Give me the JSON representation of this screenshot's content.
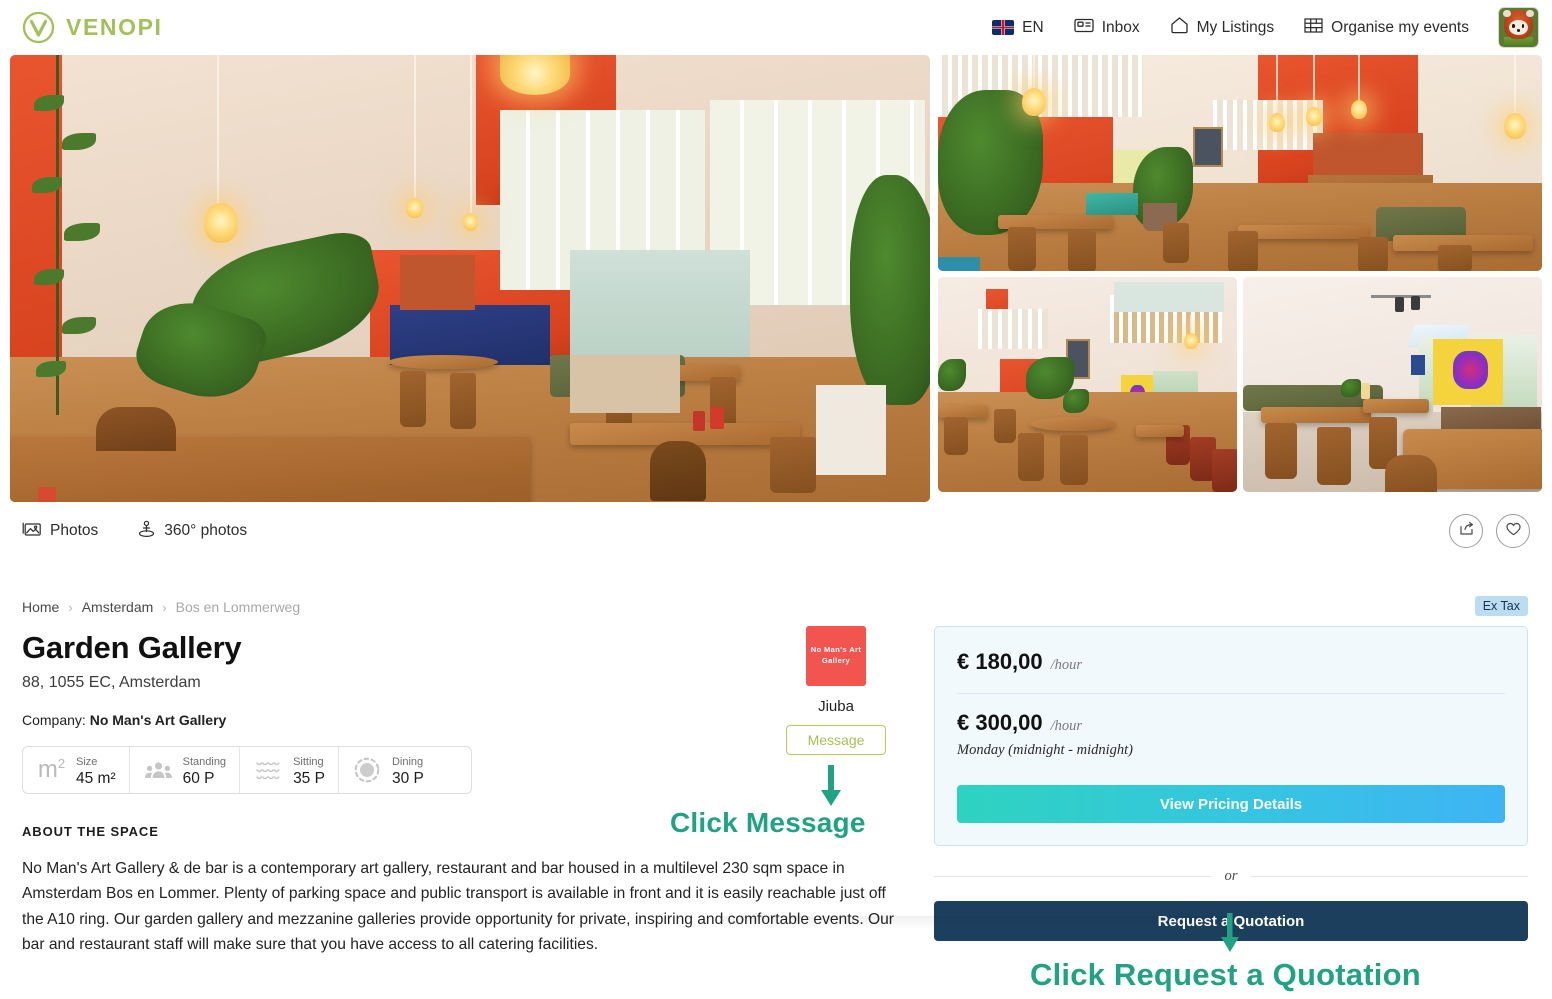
{
  "header": {
    "brand": "VENOPI",
    "brand_color": "#a4c05b",
    "nav": [
      {
        "label": "EN",
        "icon": "uk-flag-icon"
      },
      {
        "label": "Inbox",
        "icon": "inbox-icon"
      },
      {
        "label": "My Listings",
        "icon": "home-icon"
      },
      {
        "label": "Organise my events",
        "icon": "calendar-grid-icon"
      }
    ],
    "avatar_alt": "red-panda-avatar"
  },
  "gallery": {
    "tabs": [
      {
        "label": "Photos",
        "icon": "photos-icon"
      },
      {
        "label": "360° photos",
        "icon": "panorama-person-icon"
      }
    ],
    "actions": [
      {
        "name": "share-button",
        "icon": "share-icon"
      },
      {
        "name": "favourite-button",
        "icon": "heart-icon"
      }
    ]
  },
  "breadcrumb": {
    "home": "Home",
    "city": "Amsterdam",
    "street": "Bos en Lommerweg",
    "separator": "›"
  },
  "listing": {
    "title": "Garden Gallery",
    "address": "88, 1055 EC, Amsterdam",
    "company_label": "Company:",
    "company_name": "No Man's Art Gallery",
    "specs": [
      {
        "icon": "square-meter-icon",
        "label": "Size",
        "value": "45 m²"
      },
      {
        "icon": "standing-people-icon",
        "label": "Standing",
        "value": "60 P"
      },
      {
        "icon": "sitting-rows-icon",
        "label": "Sitting",
        "value": "35 P"
      },
      {
        "icon": "dining-table-icon",
        "label": "Dining",
        "value": "30 P"
      }
    ],
    "about_heading": "ABOUT THE SPACE",
    "about_text": "No Man's Art Gallery & de bar is a contemporary art gallery, restaurant and bar housed in a multilevel 230 sqm space in Amsterdam Bos en Lommer. Plenty of parking space and public transport is available in front and it is easily reachable just off the A10 ring. Our garden gallery and mezzanine galleries provide opportunity for private, inspiring and comfortable events. Our bar and restaurant staff will make sure that you have access to all catering facilities."
  },
  "host": {
    "logo_text": "No Man's Art Gallery",
    "logo_color": "#f2544f",
    "name": "Jiuba",
    "message_button": "Message",
    "message_button_color": "#a8bf55"
  },
  "booking": {
    "ex_tax_badge": "Ex Tax",
    "primary_price": "€ 180,00",
    "primary_price_unit": "/hour",
    "secondary_price": "€ 300,00",
    "secondary_price_unit": "/hour",
    "secondary_price_note": "Monday (midnight - midnight)",
    "pricing_details_button": "View Pricing Details",
    "or_text": "or",
    "quotation_button": "Request a Quotation",
    "accent_gradient_start": "#2ed3bf",
    "accent_gradient_end": "#3fb4f4",
    "quotation_color": "#1d3f5e"
  },
  "annotations": {
    "message": "Click Message",
    "quotation": "Click Request a Quotation",
    "color": "#21a283"
  }
}
